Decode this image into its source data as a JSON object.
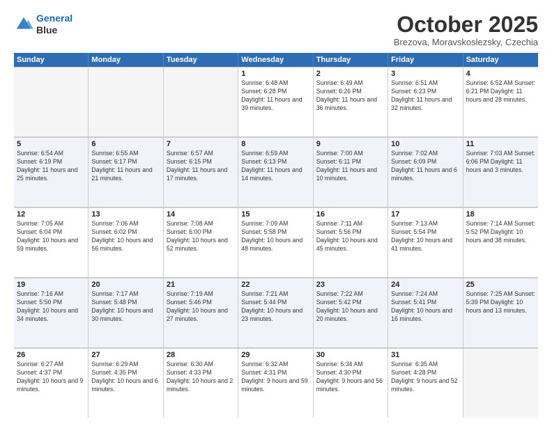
{
  "header": {
    "logo_line1": "General",
    "logo_line2": "Blue",
    "month_title": "October 2025",
    "subtitle": "Brezova, Moravskoslezsky, Czechia"
  },
  "days_of_week": [
    "Sunday",
    "Monday",
    "Tuesday",
    "Wednesday",
    "Thursday",
    "Friday",
    "Saturday"
  ],
  "weeks": [
    [
      {
        "day": "",
        "info": ""
      },
      {
        "day": "",
        "info": ""
      },
      {
        "day": "",
        "info": ""
      },
      {
        "day": "1",
        "info": "Sunrise: 6:48 AM\nSunset: 6:28 PM\nDaylight: 11 hours\nand 39 minutes."
      },
      {
        "day": "2",
        "info": "Sunrise: 6:49 AM\nSunset: 6:26 PM\nDaylight: 11 hours\nand 36 minutes."
      },
      {
        "day": "3",
        "info": "Sunrise: 6:51 AM\nSunset: 6:23 PM\nDaylight: 11 hours\nand 32 minutes."
      },
      {
        "day": "4",
        "info": "Sunrise: 6:52 AM\nSunset: 6:21 PM\nDaylight: 11 hours\nand 28 minutes."
      }
    ],
    [
      {
        "day": "5",
        "info": "Sunrise: 6:54 AM\nSunset: 6:19 PM\nDaylight: 11 hours\nand 25 minutes."
      },
      {
        "day": "6",
        "info": "Sunrise: 6:55 AM\nSunset: 6:17 PM\nDaylight: 11 hours\nand 21 minutes."
      },
      {
        "day": "7",
        "info": "Sunrise: 6:57 AM\nSunset: 6:15 PM\nDaylight: 11 hours\nand 17 minutes."
      },
      {
        "day": "8",
        "info": "Sunrise: 6:59 AM\nSunset: 6:13 PM\nDaylight: 11 hours\nand 14 minutes."
      },
      {
        "day": "9",
        "info": "Sunrise: 7:00 AM\nSunset: 6:11 PM\nDaylight: 11 hours\nand 10 minutes."
      },
      {
        "day": "10",
        "info": "Sunrise: 7:02 AM\nSunset: 6:09 PM\nDaylight: 11 hours\nand 6 minutes."
      },
      {
        "day": "11",
        "info": "Sunrise: 7:03 AM\nSunset: 6:06 PM\nDaylight: 11 hours\nand 3 minutes."
      }
    ],
    [
      {
        "day": "12",
        "info": "Sunrise: 7:05 AM\nSunset: 6:04 PM\nDaylight: 10 hours\nand 59 minutes."
      },
      {
        "day": "13",
        "info": "Sunrise: 7:06 AM\nSunset: 6:02 PM\nDaylight: 10 hours\nand 56 minutes."
      },
      {
        "day": "14",
        "info": "Sunrise: 7:08 AM\nSunset: 6:00 PM\nDaylight: 10 hours\nand 52 minutes."
      },
      {
        "day": "15",
        "info": "Sunrise: 7:09 AM\nSunset: 5:58 PM\nDaylight: 10 hours\nand 48 minutes."
      },
      {
        "day": "16",
        "info": "Sunrise: 7:11 AM\nSunset: 5:56 PM\nDaylight: 10 hours\nand 45 minutes."
      },
      {
        "day": "17",
        "info": "Sunrise: 7:13 AM\nSunset: 5:54 PM\nDaylight: 10 hours\nand 41 minutes."
      },
      {
        "day": "18",
        "info": "Sunrise: 7:14 AM\nSunset: 5:52 PM\nDaylight: 10 hours\nand 38 minutes."
      }
    ],
    [
      {
        "day": "19",
        "info": "Sunrise: 7:16 AM\nSunset: 5:50 PM\nDaylight: 10 hours\nand 34 minutes."
      },
      {
        "day": "20",
        "info": "Sunrise: 7:17 AM\nSunset: 5:48 PM\nDaylight: 10 hours\nand 30 minutes."
      },
      {
        "day": "21",
        "info": "Sunrise: 7:19 AM\nSunset: 5:46 PM\nDaylight: 10 hours\nand 27 minutes."
      },
      {
        "day": "22",
        "info": "Sunrise: 7:21 AM\nSunset: 5:44 PM\nDaylight: 10 hours\nand 23 minutes."
      },
      {
        "day": "23",
        "info": "Sunrise: 7:22 AM\nSunset: 5:42 PM\nDaylight: 10 hours\nand 20 minutes."
      },
      {
        "day": "24",
        "info": "Sunrise: 7:24 AM\nSunset: 5:41 PM\nDaylight: 10 hours\nand 16 minutes."
      },
      {
        "day": "25",
        "info": "Sunrise: 7:25 AM\nSunset: 5:39 PM\nDaylight: 10 hours\nand 13 minutes."
      }
    ],
    [
      {
        "day": "26",
        "info": "Sunrise: 6:27 AM\nSunset: 4:37 PM\nDaylight: 10 hours\nand 9 minutes."
      },
      {
        "day": "27",
        "info": "Sunrise: 6:29 AM\nSunset: 4:35 PM\nDaylight: 10 hours\nand 6 minutes."
      },
      {
        "day": "28",
        "info": "Sunrise: 6:30 AM\nSunset: 4:33 PM\nDaylight: 10 hours\nand 2 minutes."
      },
      {
        "day": "29",
        "info": "Sunrise: 6:32 AM\nSunset: 4:31 PM\nDaylight: 9 hours\nand 59 minutes."
      },
      {
        "day": "30",
        "info": "Sunrise: 6:34 AM\nSunset: 4:30 PM\nDaylight: 9 hours\nand 56 minutes."
      },
      {
        "day": "31",
        "info": "Sunrise: 6:35 AM\nSunset: 4:28 PM\nDaylight: 9 hours\nand 52 minutes."
      },
      {
        "day": "",
        "info": ""
      }
    ]
  ]
}
